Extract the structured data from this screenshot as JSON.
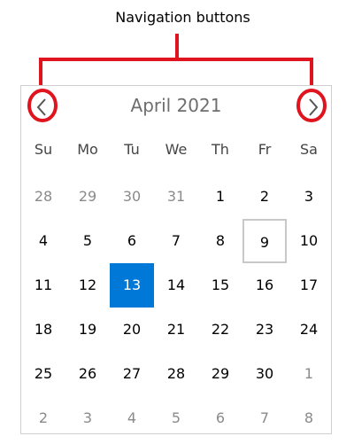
{
  "annotation": {
    "label": "Navigation buttons",
    "color": "#e0141e"
  },
  "calendar": {
    "month_title": "April 2021",
    "prev_icon": "chevron-left-icon",
    "next_icon": "chevron-right-icon",
    "weekdays": [
      "Su",
      "Mo",
      "Tu",
      "We",
      "Th",
      "Fr",
      "Sa"
    ],
    "weeks": [
      [
        {
          "d": "28",
          "other": true
        },
        {
          "d": "29",
          "other": true
        },
        {
          "d": "30",
          "other": true
        },
        {
          "d": "31",
          "other": true
        },
        {
          "d": "1"
        },
        {
          "d": "2"
        },
        {
          "d": "3"
        }
      ],
      [
        {
          "d": "4"
        },
        {
          "d": "5"
        },
        {
          "d": "6"
        },
        {
          "d": "7"
        },
        {
          "d": "8"
        },
        {
          "d": "9",
          "today": true
        },
        {
          "d": "10"
        }
      ],
      [
        {
          "d": "11"
        },
        {
          "d": "12"
        },
        {
          "d": "13",
          "selected": true
        },
        {
          "d": "14"
        },
        {
          "d": "15"
        },
        {
          "d": "16"
        },
        {
          "d": "17"
        }
      ],
      [
        {
          "d": "18"
        },
        {
          "d": "19"
        },
        {
          "d": "20"
        },
        {
          "d": "21"
        },
        {
          "d": "22"
        },
        {
          "d": "23"
        },
        {
          "d": "24"
        }
      ],
      [
        {
          "d": "25"
        },
        {
          "d": "26"
        },
        {
          "d": "27"
        },
        {
          "d": "28"
        },
        {
          "d": "29"
        },
        {
          "d": "30"
        },
        {
          "d": "1",
          "other": true
        }
      ],
      [
        {
          "d": "2",
          "other": true
        },
        {
          "d": "3",
          "other": true
        },
        {
          "d": "4",
          "other": true
        },
        {
          "d": "5",
          "other": true
        },
        {
          "d": "6",
          "other": true
        },
        {
          "d": "7",
          "other": true
        },
        {
          "d": "8",
          "other": true
        }
      ]
    ],
    "colors": {
      "selected_bg": "#0078d7",
      "today_border": "#c8c8c8",
      "other_month_text": "#8a8a8a"
    }
  }
}
